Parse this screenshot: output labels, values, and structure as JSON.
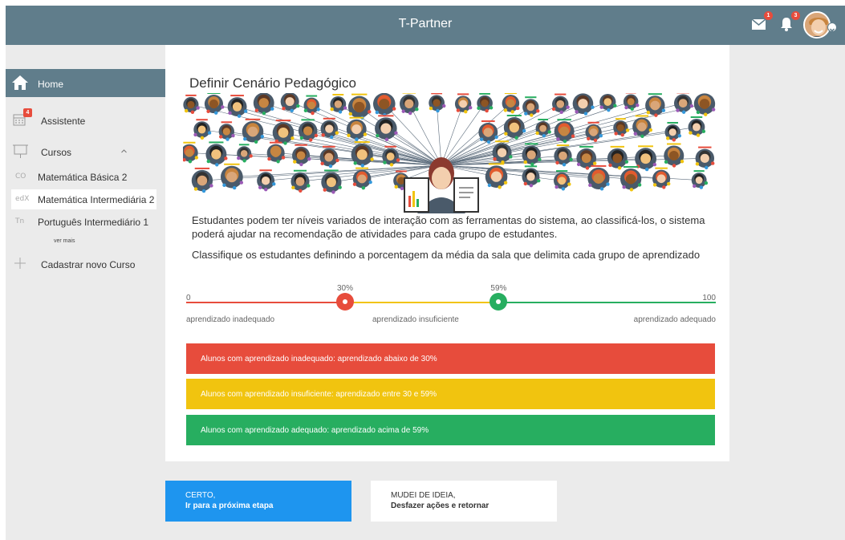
{
  "header": {
    "title": "T-Partner",
    "mail_badge": "1",
    "notification_badge": "3"
  },
  "sidebar": {
    "home": "Home",
    "assistente": "Assistente",
    "assistente_badge": "4",
    "cursos": "Cursos",
    "courses": [
      {
        "icon": "CO",
        "label": "Matemática Básica 2"
      },
      {
        "icon": "edX",
        "label": "Matemática Intermediária 2"
      },
      {
        "icon": "Tn",
        "label": "Português Intermediário 1"
      }
    ],
    "ver_mais": "ver mais",
    "new_course": "Cadastrar novo Curso"
  },
  "card": {
    "title": "Definir Cenário Pedagógico",
    "paragraph1": "Estudantes podem ter níveis variados de interação com as ferramentas do sistema, ao classificá-los, o sistema poderá ajudar na recomendação de atividades para cada grupo de estudantes.",
    "paragraph2": "Classifique os estudantes definindo a porcentagem da média da sala que delimita cada grupo de aprendizado"
  },
  "slider": {
    "min": "0",
    "max": "100",
    "value_low": 30,
    "value_high": 59,
    "value_low_label": "30%",
    "value_high_label": "59%",
    "label_low": "aprendizado inadequado",
    "label_mid": "aprendizado insuficiente",
    "label_high": "aprendizado adequado"
  },
  "bars": {
    "red": "Alunos com aprendizado inadequado: aprendizado abaixo de 30%",
    "yellow": "Alunos com aprendizado insuficiente: aprendizado entre 30 e 59%",
    "green": "Alunos com aprendizado adequado: aprendizado acima de 59%"
  },
  "buttons": {
    "next_line1": "CERTO,",
    "next_line2": "Ir para a próxima etapa",
    "undo_line1": "MUDEI DE IDEIA,",
    "undo_line2": "Desfazer ações e retornar"
  },
  "colors": {
    "header": "#607d8b",
    "red": "#e74c3c",
    "yellow": "#f1c40f",
    "green": "#27ae60",
    "primary": "#1e95ef"
  }
}
